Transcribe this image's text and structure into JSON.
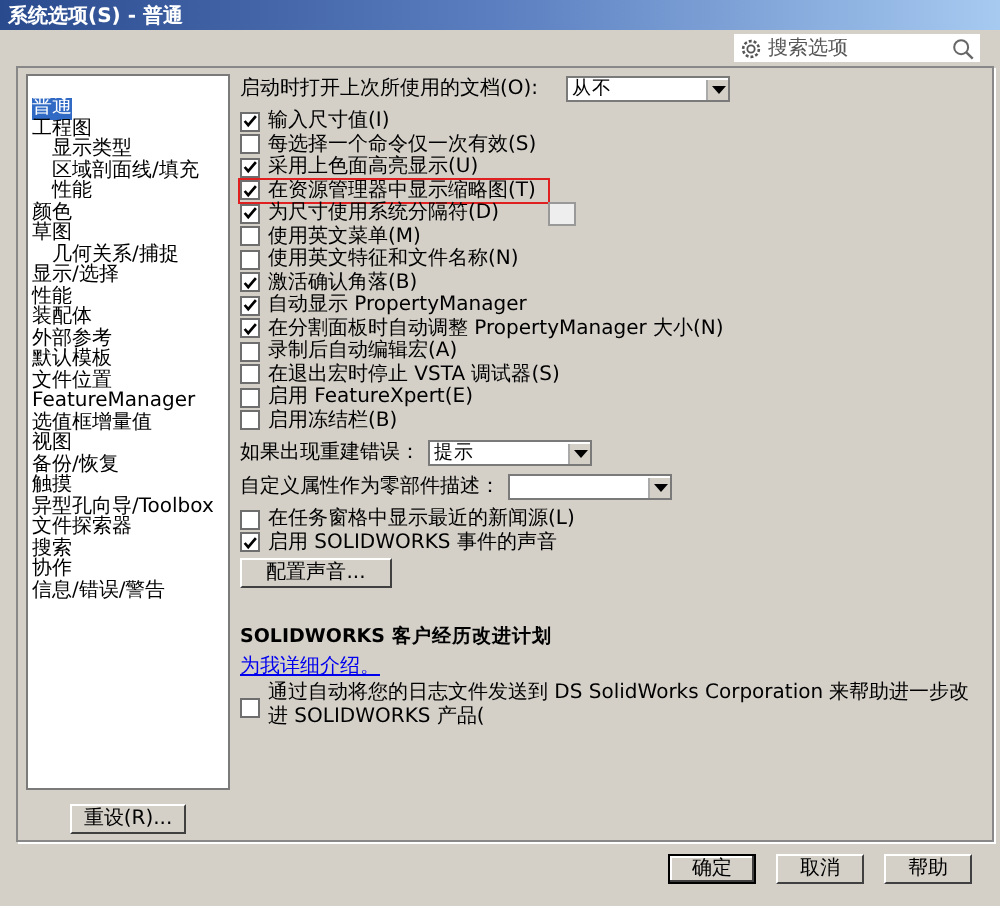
{
  "window": {
    "title": "系统选项(S) - 普通"
  },
  "search": {
    "placeholder": "搜索选项"
  },
  "tree": [
    {
      "label": "普通",
      "selected": true
    },
    {
      "label": "工程图",
      "selected": false,
      "children": [
        {
          "label": "显示类型",
          "selected": false
        },
        {
          "label": "区域剖面线/填充",
          "selected": false
        },
        {
          "label": "性能",
          "selected": false
        }
      ]
    },
    {
      "label": "颜色",
      "selected": false
    },
    {
      "label": "草图",
      "selected": false,
      "children": [
        {
          "label": "几何关系/捕捉",
          "selected": false
        }
      ]
    },
    {
      "label": "显示/选择",
      "selected": false
    },
    {
      "label": "性能",
      "selected": false
    },
    {
      "label": "装配体",
      "selected": false
    },
    {
      "label": "外部参考",
      "selected": false
    },
    {
      "label": "默认模板",
      "selected": false
    },
    {
      "label": "文件位置",
      "selected": false
    },
    {
      "label": "FeatureManager",
      "selected": false
    },
    {
      "label": "选值框增量值",
      "selected": false
    },
    {
      "label": "视图",
      "selected": false
    },
    {
      "label": "备份/恢复",
      "selected": false
    },
    {
      "label": "触摸",
      "selected": false
    },
    {
      "label": "异型孔向导/Toolbox",
      "selected": false
    },
    {
      "label": "文件探索器",
      "selected": false
    },
    {
      "label": "搜索",
      "selected": false
    },
    {
      "label": "协作",
      "selected": false
    },
    {
      "label": "信息/错误/警告",
      "selected": false
    }
  ],
  "reset_button": "重设(R)...",
  "options": [
    {
      "kind": "dropdown",
      "label": "启动时打开上次所使用的文档(O):",
      "value": "从不"
    },
    {
      "kind": "checkbox",
      "label": "输入尺寸值(I)",
      "checked": true,
      "highlighted": false,
      "field": false
    },
    {
      "kind": "checkbox",
      "label": "每选择一个命令仅一次有效(S)",
      "checked": false,
      "highlighted": false,
      "field": false
    },
    {
      "kind": "checkbox",
      "label": "采用上色面高亮显示(U)",
      "checked": true,
      "highlighted": false,
      "field": false
    },
    {
      "kind": "checkbox",
      "label": "在资源管理器中显示缩略图(T)",
      "checked": true,
      "highlighted": true,
      "field": false
    },
    {
      "kind": "checkbox",
      "label": "为尺寸使用系统分隔符(D)",
      "checked": true,
      "highlighted": false,
      "field": true
    },
    {
      "kind": "checkbox",
      "label": "使用英文菜单(M)",
      "checked": false,
      "highlighted": false,
      "field": false
    },
    {
      "kind": "checkbox",
      "label": "使用英文特征和文件名称(N)",
      "checked": false,
      "highlighted": false,
      "field": false
    },
    {
      "kind": "checkbox",
      "label": "激活确认角落(B)",
      "checked": true,
      "highlighted": false,
      "field": false
    },
    {
      "kind": "checkbox",
      "label": "自动显示 PropertyManager",
      "checked": true,
      "highlighted": false,
      "field": false
    },
    {
      "kind": "checkbox",
      "label": "在分割面板时自动调整 PropertyManager 大小(N)",
      "checked": true,
      "highlighted": false,
      "field": false
    },
    {
      "kind": "checkbox",
      "label": "录制后自动编辑宏(A)",
      "checked": false,
      "highlighted": false,
      "field": false
    },
    {
      "kind": "checkbox",
      "label": "在退出宏时停止 VSTA 调试器(S)",
      "checked": false,
      "highlighted": false,
      "field": false
    },
    {
      "kind": "checkbox",
      "label": "启用 FeatureXpert(E)",
      "checked": false,
      "highlighted": false,
      "field": false
    },
    {
      "kind": "checkbox",
      "label": "启用冻结栏(B)",
      "checked": false,
      "highlighted": false,
      "field": false
    },
    {
      "kind": "dropdown",
      "label": "如果出现重建错误：",
      "value": "提示"
    },
    {
      "kind": "dropdown",
      "label": "自定义属性作为零部件描述："
    },
    {
      "kind": "checkbox",
      "label": "在任务窗格中显示最近的新闻源(L)",
      "checked": false,
      "highlighted": false,
      "field": false
    },
    {
      "kind": "checkbox",
      "label": "启用 SOLIDWORKS 事件的声音",
      "checked": true,
      "highlighted": false,
      "field": false
    },
    {
      "kind": "button",
      "label": "配置声音..."
    }
  ],
  "program": {
    "title": "SOLIDWORKS 客户经历改进计划",
    "link": "为我详细介绍。",
    "checkbox": {
      "label": "通过自动将您的日志文件发送到 DS SolidWorks Corporation 来帮助进一步改进 SOLIDWORKS 产品(",
      "checked": false
    }
  },
  "buttons": [
    "确定",
    "取消",
    "帮助"
  ]
}
